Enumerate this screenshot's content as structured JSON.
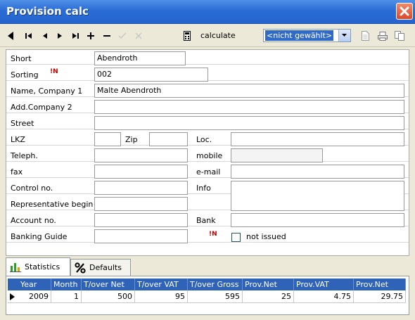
{
  "window": {
    "title": "Provision calc"
  },
  "toolbar": {
    "calculate_label": "calculate",
    "selector_value": "<nicht gewählt>"
  },
  "form": {
    "labels": {
      "short": "Short",
      "sorting": "Sorting",
      "name_company1": "Name, Company 1",
      "add_company2": "Add.Company 2",
      "street": "Street",
      "lkz": "LKZ",
      "zip": "Zip",
      "loc": "Loc.",
      "teleph": "Teleph.",
      "mobile": "mobile",
      "fax": "fax",
      "email": "e-mail",
      "control_no": "Control no.",
      "info": "Info",
      "representative_begin": "Representative begin",
      "account_no": "Account no.",
      "bank": "Bank",
      "banking_guide": "Banking Guide",
      "not_issued": "not issued"
    },
    "values": {
      "short": "Abendroth",
      "sorting": "002",
      "name_company1": "Malte Abendroth",
      "add_company2": "",
      "street": "",
      "lkz": "",
      "zip": "",
      "loc": "",
      "teleph": "",
      "mobile": "",
      "fax": "",
      "email": "",
      "control_no": "",
      "info": "",
      "representative_begin": "",
      "account_no": "",
      "bank": "",
      "banking_guide": "",
      "not_issued": false
    },
    "marker_text": "N"
  },
  "tabs": [
    {
      "label": "Statistics",
      "icon": "bar-chart-icon",
      "active": true
    },
    {
      "label": "Defaults",
      "icon": "percent-icon",
      "active": false
    }
  ],
  "grid": {
    "columns": [
      "Year",
      "Month",
      "T/over Net",
      "T/over VAT",
      "T/over Gross",
      "Prov.Net",
      "Prov.VAT",
      "Prov.Net"
    ],
    "rows": [
      [
        "2009",
        "1",
        "500",
        "95",
        "595",
        "25",
        "4.75",
        "29.75"
      ]
    ]
  },
  "colors": {
    "titlebar": "#2a6dd7",
    "grid_header": "#2e63b8",
    "selection": "#316ac5",
    "close": "#d9492a"
  }
}
